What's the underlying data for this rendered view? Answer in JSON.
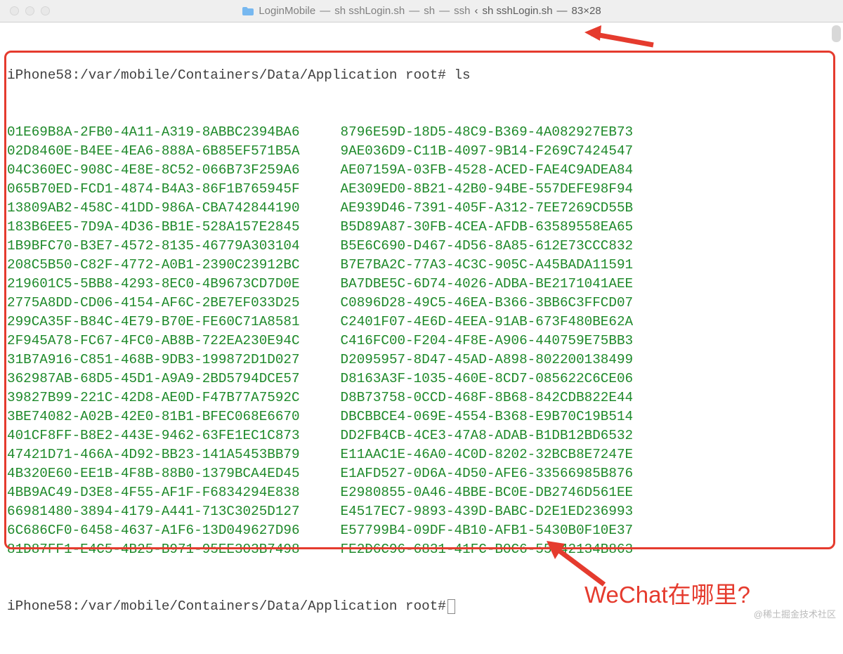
{
  "titlebar": {
    "folder_name": "LoginMobile",
    "segments": [
      "sh sshLogin.sh",
      "sh",
      "ssh"
    ],
    "tab_indicator": "‹",
    "active_segment": "sh sshLogin.sh",
    "dims": "83×28"
  },
  "terminal": {
    "prompt1_host": "iPhone58",
    "prompt1_path": "/var/mobile/Containers/Data/Application",
    "prompt1_user": "root#",
    "command": "ls",
    "prompt2_host": "iPhone58",
    "prompt2_path": "/var/mobile/Containers/Data/Application",
    "prompt2_user": "root#",
    "ls_left": [
      "01E69B8A-2FB0-4A11-A319-8ABBC2394BA6",
      "02D8460E-B4EE-4EA6-888A-6B85EF571B5A",
      "04C360EC-908C-4E8E-8C52-066B73F259A6",
      "065B70ED-FCD1-4874-B4A3-86F1B765945F",
      "13809AB2-458C-41DD-986A-CBA742844190",
      "183B6EE5-7D9A-4D36-BB1E-528A157E2845",
      "1B9BFC70-B3E7-4572-8135-46779A303104",
      "208C5B50-C82F-4772-A0B1-2390C23912BC",
      "219601C5-5BB8-4293-8EC0-4B9673CD7D0E",
      "2775A8DD-CD06-4154-AF6C-2BE7EF033D25",
      "299CA35F-B84C-4E79-B70E-FE60C71A8581",
      "2F945A78-FC67-4FC0-AB8B-722EA230E94C",
      "31B7A916-C851-468B-9DB3-199872D1D027",
      "362987AB-68D5-45D1-A9A9-2BD5794DCE57",
      "39827B99-221C-42D8-AE0D-F47B77A7592C",
      "3BE74082-A02B-42E0-81B1-BFEC068E6670",
      "401CF8FF-B8E2-443E-9462-63FE1EC1C873",
      "47421D71-466A-4D92-BB23-141A5453BB79",
      "4B320E60-EE1B-4F8B-88B0-1379BCA4ED45",
      "4BB9AC49-D3E8-4F55-AF1F-F6834294E838",
      "66981480-3894-4179-A441-713C3025D127",
      "6C686CF0-6458-4637-A1F6-13D049627D96",
      "81D87FF1-E4C5-4B25-B971-95EE303B7498"
    ],
    "ls_right": [
      "8796E59D-18D5-48C9-B369-4A082927EB73",
      "9AE036D9-C11B-4097-9B14-F269C7424547",
      "AE07159A-03FB-4528-ACED-FAE4C9ADEA84",
      "AE309ED0-8B21-42B0-94BE-557DEFE98F94",
      "AE939D46-7391-405F-A312-7EE7269CD55B",
      "B5D89A87-30FB-4CEA-AFDB-63589558EA65",
      "B5E6C690-D467-4D56-8A85-612E73CCC832",
      "B7E7BA2C-77A3-4C3C-905C-A45BADA11591",
      "BA7DBE5C-6D74-4026-ADBA-BE2171041AEE",
      "C0896D28-49C5-46EA-B366-3BB6C3FFCD07",
      "C2401F07-4E6D-4EEA-91AB-673F480BE62A",
      "C416FC00-F204-4F8E-A906-440759E75BB3",
      "D2095957-8D47-45AD-A898-802200138499",
      "D8163A3F-1035-460E-8CD7-085622C6CE06",
      "D8B73758-0CCD-468F-8B68-842CDB822E44",
      "DBCBBCE4-069E-4554-B368-E9B70C19B514",
      "DD2FB4CB-4CE3-47A8-ADAB-B1DB12BD6532",
      "E11AAC1E-46A0-4C0D-8202-32BCB8E7247E",
      "E1AFD527-0D6A-4D50-AFE6-33566985B876",
      "E2980855-0A46-4BBE-BC0E-DB2746D561EE",
      "E4517EC7-9893-439D-BABC-D2E1ED236993",
      "E57799B4-09DF-4B10-AFB1-5430B0F10E37",
      "FE2D6C96-6831-41FC-B0C6-55942134B863"
    ]
  },
  "annotation_text": "WeChat在哪里?",
  "watermark_text": "@稀土掘金技术社区"
}
